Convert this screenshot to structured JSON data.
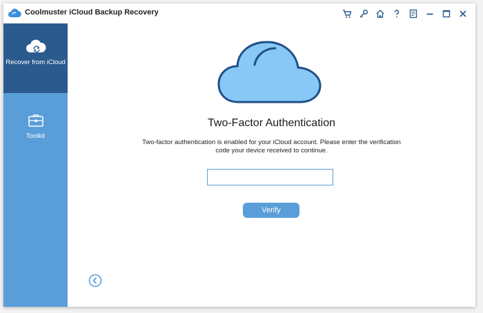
{
  "window": {
    "title": "Coolmuster iCloud Backup Recovery",
    "titlebar_icons": [
      "cart-icon",
      "key-icon",
      "home-icon",
      "help-icon",
      "feedback-icon",
      "minimize-icon",
      "maximize-icon",
      "close-icon"
    ]
  },
  "sidebar": {
    "items": [
      {
        "label": "Recover from iCloud",
        "icon": "cloud-sync-icon",
        "active": true
      },
      {
        "label": "Toolkit",
        "icon": "toolbox-icon",
        "active": false
      }
    ]
  },
  "main": {
    "illustration": "cloud-icon",
    "heading": "Two-Factor Authentication",
    "description": "Two-factor authentication is enabled for your iCloud account. Please enter the verification code your device received to continue.",
    "code_input": {
      "value": "",
      "placeholder": ""
    },
    "verify_label": "Verify",
    "back_icon": "back-arrow-icon"
  },
  "colors": {
    "sidebar_bg": "#5a9ed9",
    "sidebar_active_bg": "#2b5a8e",
    "accent": "#5a9ed9",
    "cloud_fill": "#88c8f7",
    "cloud_stroke": "#1f4f86",
    "titlebar_icon": "#2b5a8e"
  }
}
